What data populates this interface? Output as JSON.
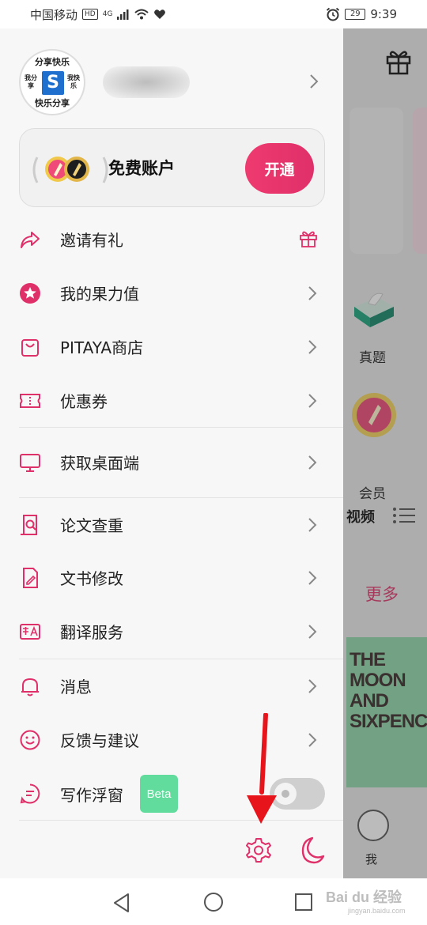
{
  "status_bar": {
    "carrier": "中国移动",
    "hd": "HD",
    "net": "4G",
    "battery": "29",
    "time": "9:39"
  },
  "profile": {
    "avatar_top": "分享快乐",
    "avatar_bottom": "快乐分享",
    "avatar_left": "我分享",
    "avatar_right": "我快乐",
    "avatar_logo": "S"
  },
  "account": {
    "title": "免费账户",
    "button": "开通"
  },
  "menu": [
    {
      "label": "邀请有礼",
      "icon": "share-arrow-icon"
    },
    {
      "label": "我的果力值",
      "icon": "star-circle-icon"
    },
    {
      "label": "PITAYA商店",
      "icon": "shopping-bag-icon"
    },
    {
      "label": "优惠券",
      "icon": "ticket-icon"
    },
    {
      "label": "获取桌面端",
      "icon": "monitor-icon"
    },
    {
      "label": "论文查重",
      "icon": "document-search-icon"
    },
    {
      "label": "文书修改",
      "icon": "document-edit-icon"
    },
    {
      "label": "翻译服务",
      "icon": "translate-icon"
    },
    {
      "label": "消息",
      "icon": "bell-icon"
    },
    {
      "label": "反馈与建议",
      "icon": "smile-icon"
    },
    {
      "label": "写作浮窗",
      "icon": "chat-window-icon"
    }
  ],
  "beta_label": "Beta",
  "background_app": {
    "label_zhenti": "真题",
    "label_huiyuan": "会员",
    "label_video": "视频",
    "label_more": "更多",
    "book_title": "THE MOON AND SIXPENCE",
    "label_me": "我"
  },
  "watermark": {
    "main": "Bai du 经验",
    "sub": "jingyan.baidu.com"
  },
  "colors": {
    "accent": "#e0306a",
    "beta": "#62dc9c",
    "arrow": "#e8141c"
  }
}
